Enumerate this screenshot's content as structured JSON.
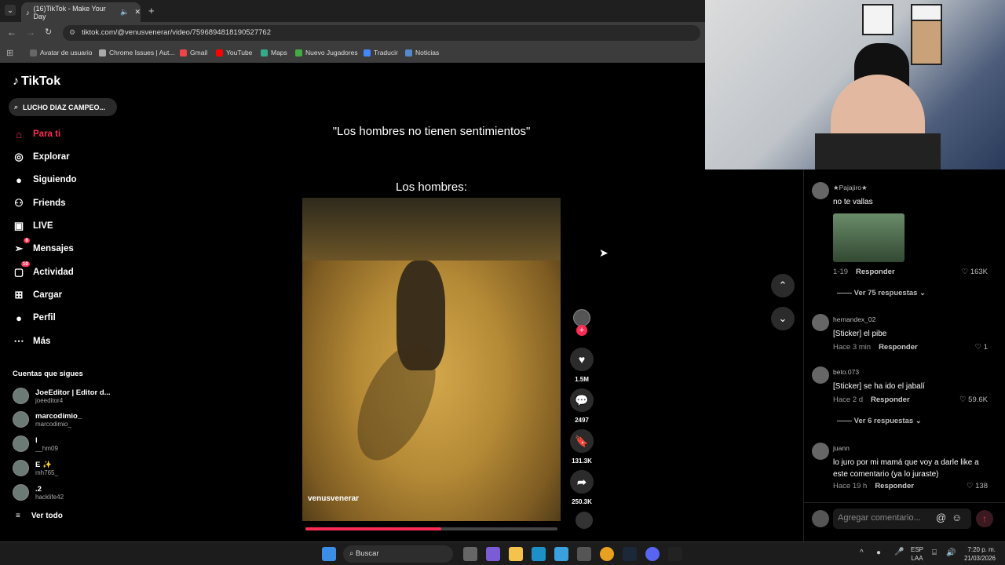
{
  "browser": {
    "tab_title": "(16)TikTok - Make Your Day",
    "url": "tiktok.com/@venusvenerar/video/7596894818190527762",
    "bookmarks": [
      "Avatar de usuario",
      "Chrome Issues | Aut...",
      "Gmail",
      "YouTube",
      "Maps",
      "Nuevo Jugadores",
      "Traducir",
      "Noticias"
    ]
  },
  "app": {
    "logo": "TikTok",
    "search_value": "LUCHO DIAZ CAMPEO...",
    "nav": [
      {
        "label": "Para ti",
        "icon": "home-icon"
      },
      {
        "label": "Explorar",
        "icon": "compass-icon"
      },
      {
        "label": "Siguiendo",
        "icon": "following-avatar-icon"
      },
      {
        "label": "Friends",
        "icon": "friends-icon"
      },
      {
        "label": "LIVE",
        "icon": "live-icon"
      },
      {
        "label": "Mensajes",
        "icon": "messages-icon",
        "badge": "6"
      },
      {
        "label": "Actividad",
        "icon": "activity-icon",
        "badge": "10"
      },
      {
        "label": "Cargar",
        "icon": "upload-icon"
      },
      {
        "label": "Perfil",
        "icon": "profile-icon"
      },
      {
        "label": "Más",
        "icon": "more-icon"
      }
    ],
    "following_title": "Cuentas que sigues",
    "accounts": [
      {
        "name": "JoeEditor | Editor d...",
        "handle": "joeeditor4"
      },
      {
        "name": "marcodimio_",
        "handle": "marcodimio_"
      },
      {
        "name": "l",
        "handle": "__hm09"
      },
      {
        "name": "E ✨",
        "handle": "mh765_"
      },
      {
        "name": ".2",
        "handle": "hacklife42"
      }
    ],
    "see_all": "Ver todo"
  },
  "video": {
    "caption_top": "\"Los hombres no tienen sentimientos\"",
    "caption_bottom": "Los hombres:",
    "author": "venusvenerar",
    "progress": 0.54
  },
  "actions": {
    "likes": "1.5M",
    "comments": "2497",
    "saves": "131.3K",
    "shares": "250.3K"
  },
  "comments": [
    {
      "user": "★Pajajiro★",
      "text": "no te vallas",
      "date": "1-19",
      "reply": "Responder",
      "likes": "163K",
      "more": "Ver 75 respuestas"
    },
    {
      "user": "hernandex_02",
      "text": "[Sticker] el pibe",
      "date": "Hace 3 min",
      "reply": "Responder",
      "likes": "1"
    },
    {
      "user": "beto.073",
      "text": "[Sticker] se ha ido el jabalí",
      "date": "Hace 2 d",
      "reply": "Responder",
      "likes": "59.6K",
      "more": "Ver 6 respuestas"
    },
    {
      "user": "juann",
      "text": "lo juro por mi mamá que voy a darle like a este comentario (ya lo juraste)",
      "date": "Hace 19 h",
      "reply": "Responder",
      "likes": "138"
    }
  ],
  "comment_input": {
    "placeholder": "Agregar comentario..."
  },
  "taskbar": {
    "search": "Buscar",
    "lang": "ESP",
    "lang2": "LAA",
    "time": "7:20 p. m.",
    "date": "21/03/2026"
  },
  "colors": {
    "accent": "#fe2c55"
  }
}
